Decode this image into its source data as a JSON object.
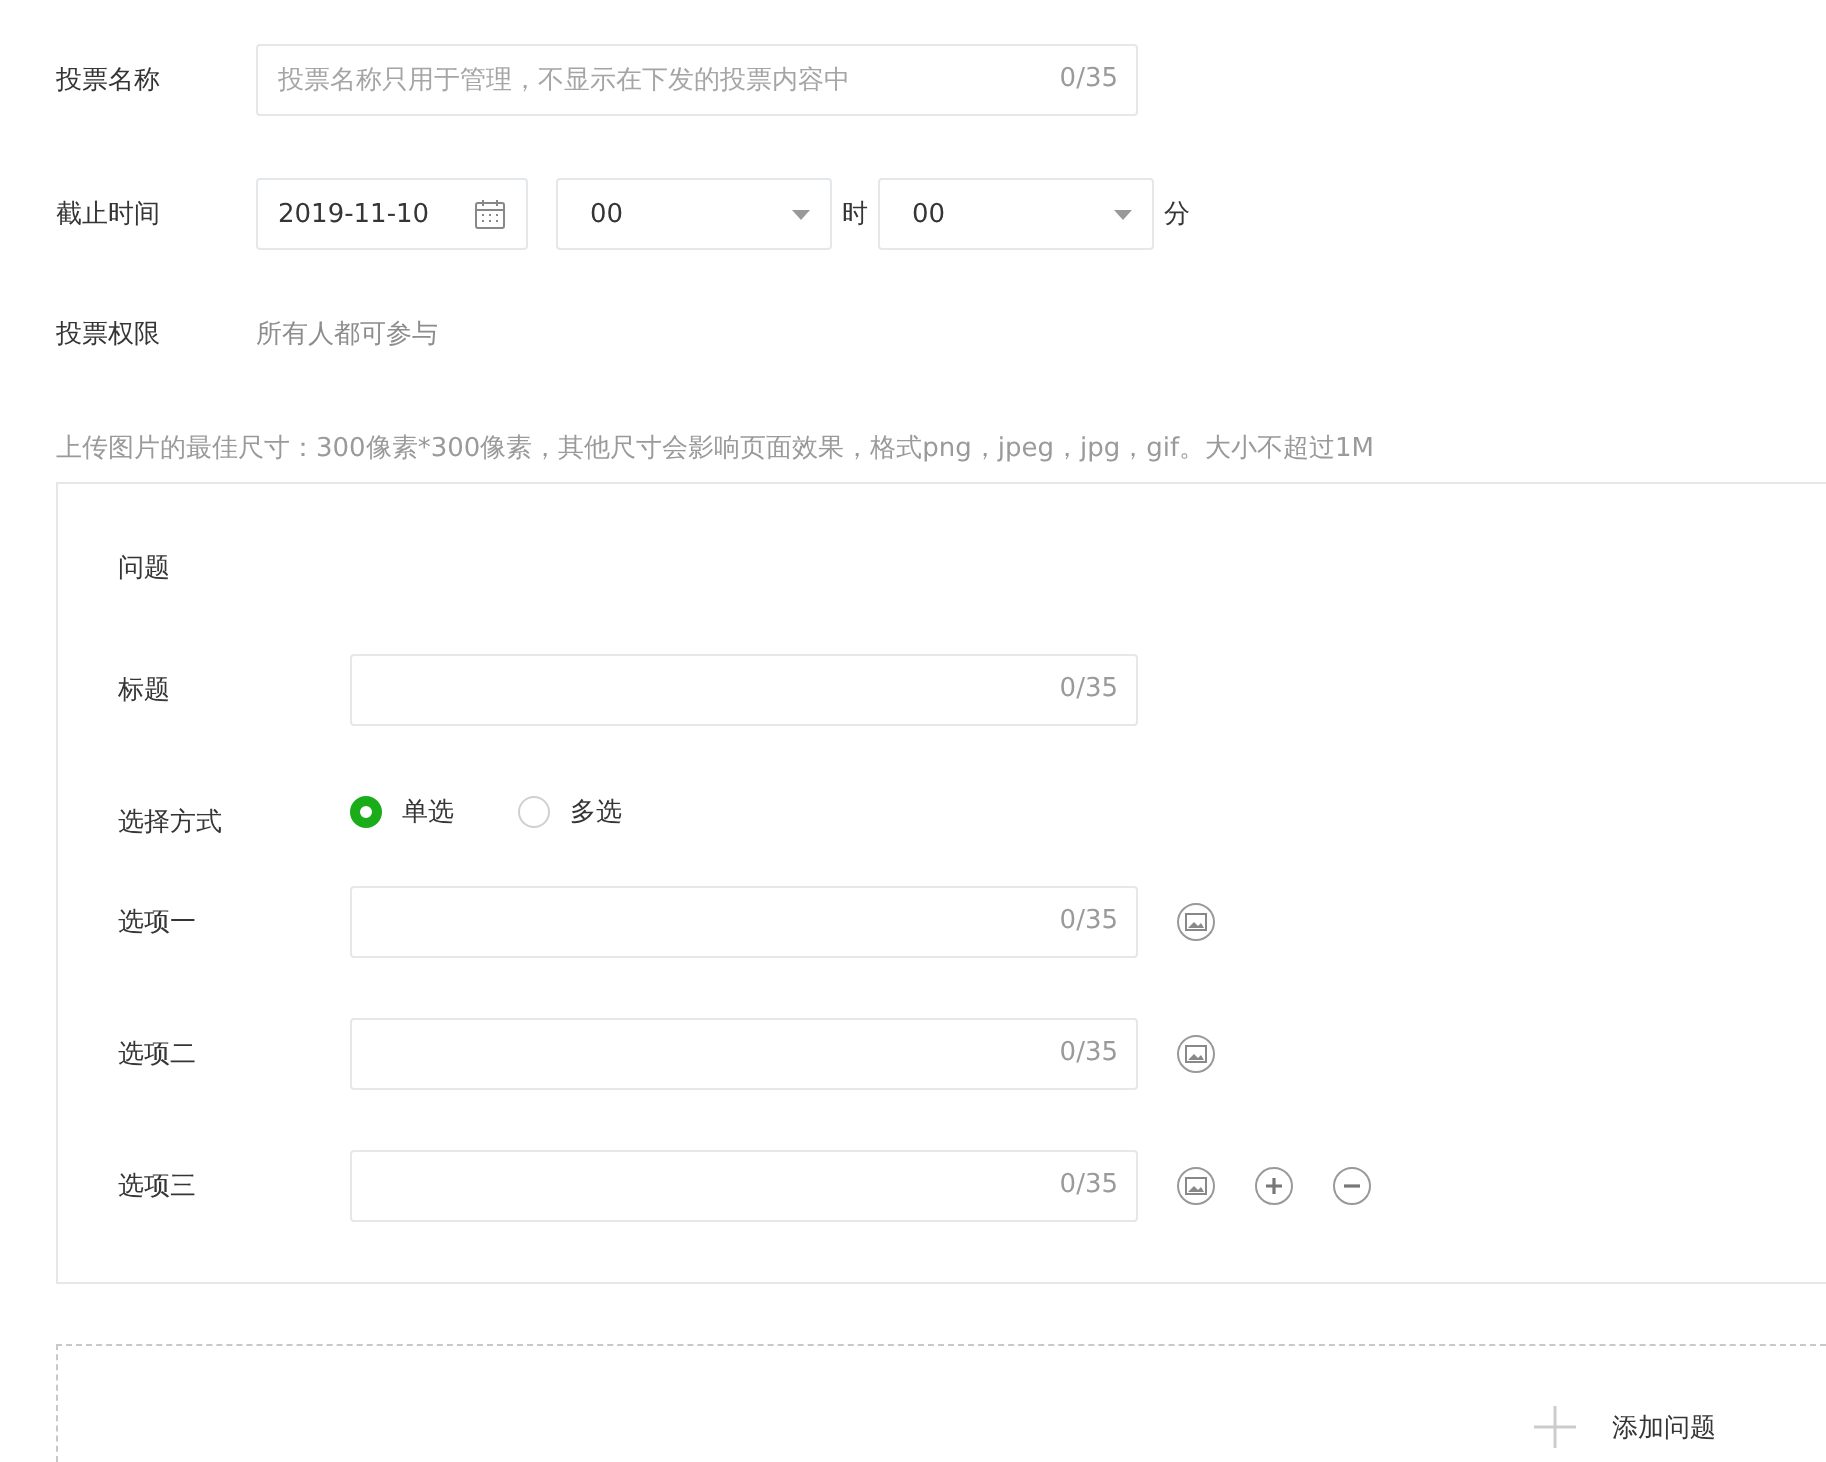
{
  "vote_name": {
    "label": "投票名称",
    "placeholder": "投票名称只用于管理，不显示在下发的投票内容中",
    "counter": "0/35"
  },
  "deadline": {
    "label": "截止时间",
    "date": "2019-11-10",
    "hour": "00",
    "hour_unit": "时",
    "minute": "00",
    "minute_unit": "分"
  },
  "permission": {
    "label": "投票权限",
    "value": "所有人都可参与"
  },
  "upload_hint": "上传图片的最佳尺寸：300像素*300像素，其他尺寸会影响页面效果，格式png，jpeg，jpg，gif。大小不超过1M",
  "question": {
    "heading": "问题",
    "title": {
      "label": "标题",
      "counter": "0/35"
    },
    "mode": {
      "label": "选择方式",
      "choices": [
        {
          "label": "单选",
          "selected": true
        },
        {
          "label": "多选",
          "selected": false
        }
      ]
    },
    "options": [
      {
        "label": "选项一",
        "counter": "0/35",
        "actions": [
          {
            "kind": "image"
          }
        ]
      },
      {
        "label": "选项二",
        "counter": "0/35",
        "actions": [
          {
            "kind": "image"
          }
        ]
      },
      {
        "label": "选项三",
        "counter": "0/35",
        "actions": [
          {
            "kind": "image"
          },
          {
            "kind": "add"
          },
          {
            "kind": "remove"
          }
        ]
      }
    ]
  },
  "add_question": "添加问题"
}
